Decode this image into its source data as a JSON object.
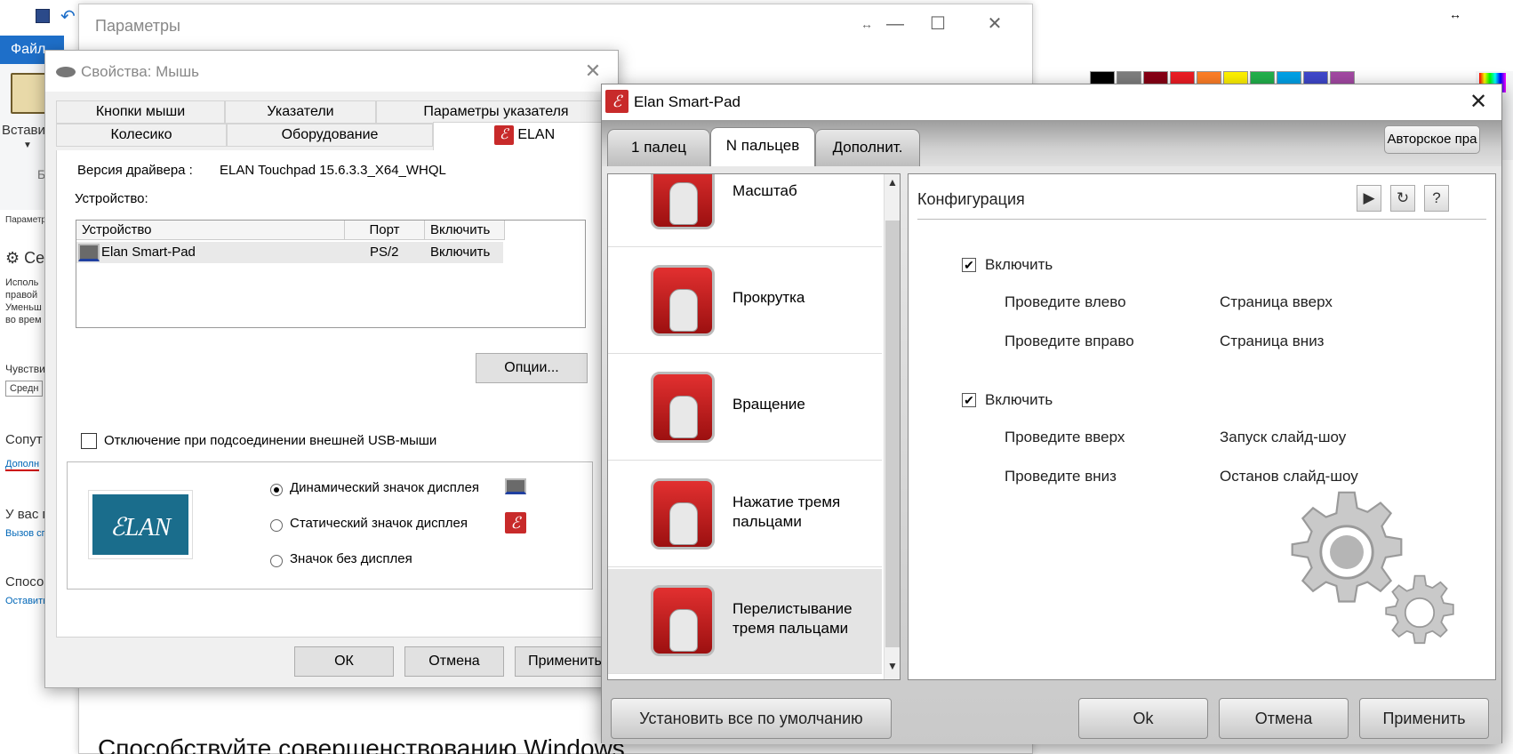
{
  "paint": {
    "file_tab": "Файл",
    "paste_label": "Вставит",
    "group_label": "Б",
    "palette": [
      "#000000",
      "#7f7f7f",
      "#880015",
      "#ed1c24",
      "#ff7f27",
      "#fff200",
      "#22b14c",
      "#00a2e8",
      "#3f48cc",
      "#a349a4"
    ],
    "bottom_text": "Способствуйте совершенствованию Windows"
  },
  "settings_bg": {
    "header": "Параметры",
    "section_title": "Се",
    "para": [
      "Исполь",
      "правой",
      "Уменьш",
      "во врем"
    ],
    "sens_label": "Чувстви",
    "sens_value": "Средн",
    "related": "Сопут",
    "more_link": "Дополн",
    "have_q": "У вас п",
    "help_link": "Вызов сп",
    "ways": "Способ",
    "leave_link": "Оставить"
  },
  "params": {
    "title": "Параметры"
  },
  "mouse": {
    "title": "Свойства: Мышь",
    "tabs_row1": [
      "Кнопки мыши",
      "Указатели",
      "Параметры указателя"
    ],
    "tabs_row2": [
      "Колесико",
      "Оборудование",
      "ELAN"
    ],
    "driver_label": "Версия драйвера :",
    "driver_value": "ELAN Touchpad 15.6.3.3_X64_WHQL",
    "device_label": "Устройство:",
    "columns": [
      "Устройство",
      "Порт",
      "Включить"
    ],
    "row": [
      "Elan Smart-Pad",
      "PS/2",
      "Включить"
    ],
    "options_button": "Опции...",
    "usb_checkbox": "Отключение при подсоединении внешней USB-мыши",
    "logo_text": "LAN",
    "radio_dynamic": "Динамический значок дисплея",
    "radio_static": "Статический значок дисплея",
    "radio_none": "Значок без дисплея",
    "ok": "ОК",
    "cancel": "Отмена",
    "apply": "Применить"
  },
  "elan": {
    "title": "Elan Smart-Pad",
    "tabs": [
      "1 палец",
      "N пальцев",
      "Дополнит."
    ],
    "copyright_button": "Авторское пра",
    "gestures": [
      "Масштаб",
      "Прокрутка",
      "Вращение",
      "Нажатие тремя пальцами",
      "Перелистывание тремя пальцами"
    ],
    "config_title": "Конфигурация",
    "enable": "Включить",
    "group1": [
      [
        "Проведите влево",
        "Страница вверх"
      ],
      [
        "Проведите вправо",
        "Страница вниз"
      ]
    ],
    "group2": [
      [
        "Проведите вверх",
        "Запуск слайд-шоу"
      ],
      [
        "Проведите вниз",
        "Останов слайд-шоу"
      ]
    ],
    "defaults_button": "Установить все по умолчанию",
    "ok": "Ok",
    "cancel": "Отмена",
    "apply": "Применить"
  }
}
